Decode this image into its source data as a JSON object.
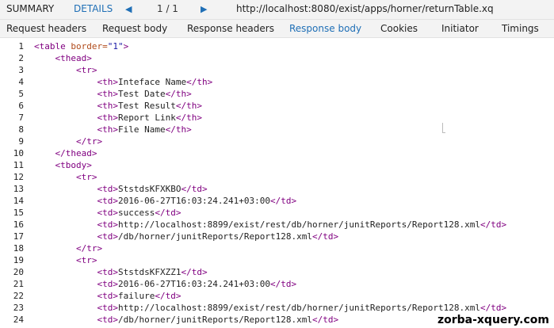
{
  "topbar": {
    "summary": "SUMMARY",
    "details": "DETAILS",
    "prev_icon": "◀",
    "page": "1 / 1",
    "next_icon": "▶",
    "url": "http://localhost:8080/exist/apps/horner/returnTable.xq"
  },
  "tabs": [
    {
      "label": "Request headers"
    },
    {
      "label": "Request body"
    },
    {
      "label": "Response headers"
    },
    {
      "label": "Response body"
    },
    {
      "label": "Cookies"
    },
    {
      "label": "Initiator"
    },
    {
      "label": "Timings"
    }
  ],
  "code_lines": [
    {
      "n": "1",
      "text": "<table border=\"1\">"
    },
    {
      "n": "2",
      "text": "    <thead>"
    },
    {
      "n": "3",
      "text": "        <tr>"
    },
    {
      "n": "4",
      "text": "            <th>Inteface Name</th>"
    },
    {
      "n": "5",
      "text": "            <th>Test Date</th>"
    },
    {
      "n": "6",
      "text": "            <th>Test Result</th>"
    },
    {
      "n": "7",
      "text": "            <th>Report Link</th>"
    },
    {
      "n": "8",
      "text": "            <th>File Name</th>"
    },
    {
      "n": "9",
      "text": "        </tr>"
    },
    {
      "n": "10",
      "text": "    </thead>"
    },
    {
      "n": "11",
      "text": "    <tbody>"
    },
    {
      "n": "12",
      "text": "        <tr>"
    },
    {
      "n": "13",
      "text": "            <td>StstdsKFXKBO</td>"
    },
    {
      "n": "14",
      "text": "            <td>2016-06-27T16:03:24.241+03:00</td>"
    },
    {
      "n": "15",
      "text": "            <td>success</td>"
    },
    {
      "n": "16",
      "text": "            <td>http://localhost:8899/exist/rest/db/horner/junitReports/Report128.xml</td>"
    },
    {
      "n": "17",
      "text": "            <td>/db/horner/junitReports/Report128.xml</td>"
    },
    {
      "n": "18",
      "text": "        </tr>"
    },
    {
      "n": "19",
      "text": "        <tr>"
    },
    {
      "n": "20",
      "text": "            <td>StstdsKFXZZ1</td>"
    },
    {
      "n": "21",
      "text": "            <td>2016-06-27T16:03:24.241+03:00</td>"
    },
    {
      "n": "22",
      "text": "            <td>failure</td>"
    },
    {
      "n": "23",
      "text": "            <td>http://localhost:8899/exist/rest/db/horner/junitReports/Report128.xml</td>"
    },
    {
      "n": "24",
      "text": "            <td>/db/horner/junitReports/Report128.xml</td>"
    }
  ],
  "watermark": "zorba-xquery.com"
}
